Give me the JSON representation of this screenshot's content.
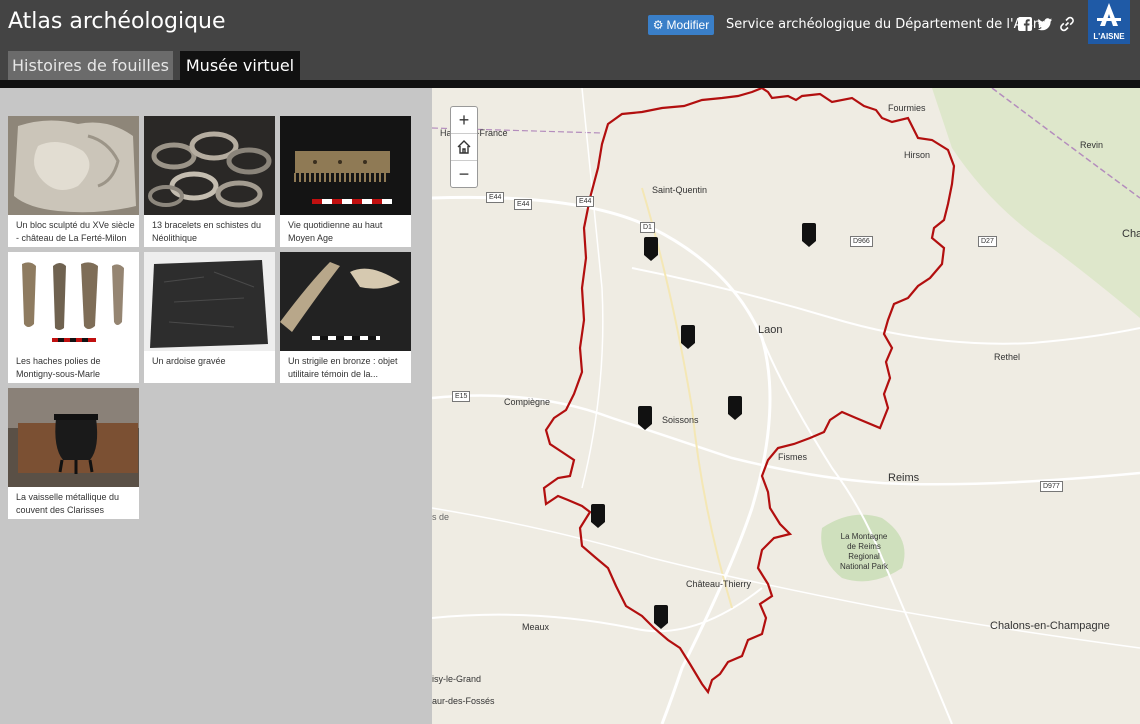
{
  "header": {
    "title": "Atlas archéologique",
    "modify_label": "Modifier",
    "service": "Service archéologique du Département de l'Aisne",
    "logo_text": "L'AISNE"
  },
  "tabs": [
    {
      "label": "Histoires de fouilles",
      "active": false
    },
    {
      "label": "Musée virtuel",
      "active": true
    }
  ],
  "gallery": [
    {
      "caption": "Un bloc sculpté du XVe siècle - château de La Ferté-Milon"
    },
    {
      "caption": "13 bracelets en schistes du Néolithique"
    },
    {
      "caption": "Vie quotidienne au haut Moyen Age"
    },
    {
      "caption": "Les haches polies de Montigny-sous-Marle"
    },
    {
      "caption": "Un ardoise gravée"
    },
    {
      "caption": "Un strigile en bronze : objet utilitaire témoin de la..."
    },
    {
      "caption": "La vaisselle métallique du couvent des Clarisses"
    }
  ],
  "map": {
    "zoom_in": "+",
    "zoom_out": "−",
    "places": {
      "fourmies": "Fourmies",
      "hirson": "Hirson",
      "revin": "Revin",
      "charleville": "Charle",
      "saint_quentin": "Saint-Quentin",
      "laon": "Laon",
      "rethel": "Rethel",
      "compiegne": "Compiègne",
      "soissons": "Soissons",
      "fismes": "Fismes",
      "reims": "Reims",
      "montagne": "La Montagne\nde Reims\nRegional\nNational Park",
      "chateau_thierry": "Château-Thierry",
      "meaux": "Meaux",
      "chalons": "Chalons-en-Champagne",
      "hauts_de_france": "Hauts-de-France",
      "noisy": "isy-le-Grand",
      "saint_maur": "aur-des-Fossés",
      "partial_de": "s de"
    },
    "roads": {
      "e44a": "E44",
      "e44b": "E44",
      "e44c": "E44",
      "d1": "D1",
      "d966": "D966",
      "d27": "D27",
      "e15": "E15",
      "d977": "D977"
    },
    "colors": {
      "boundary": "#b20f0f",
      "marker": "#111111"
    }
  }
}
